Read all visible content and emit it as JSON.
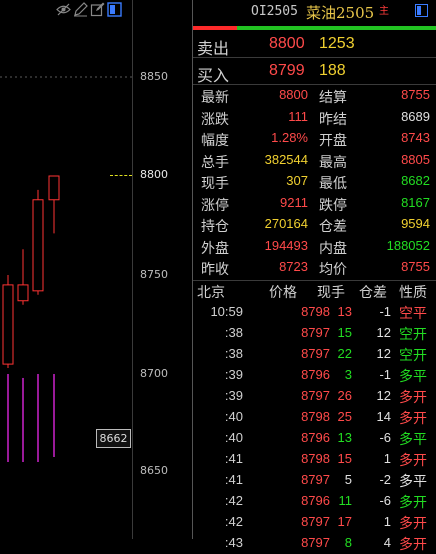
{
  "chart": {
    "price_labels": [
      "8850",
      "8800",
      "8750",
      "8700",
      "8650"
    ],
    "last_price_tag": "8800",
    "crosshair_tag": "8662",
    "candles": [
      {
        "open": 8705,
        "close": 8745,
        "high": 8750,
        "low": 8703,
        "color": "#ff3333"
      },
      {
        "open": 8745,
        "close": 8737,
        "high": 8763,
        "low": 8735,
        "color": "#ff3333"
      },
      {
        "open": 8742,
        "close": 8788,
        "high": 8793,
        "low": 8740,
        "color": "#ff3333"
      },
      {
        "open": 8788,
        "close": 8800,
        "high": 8800,
        "low": 8771,
        "color": "#ff3333"
      }
    ],
    "volume_bars": [
      8700,
      8698,
      8700,
      8700
    ],
    "colors": {
      "up": "#ff3333",
      "volume": "#cc22cc",
      "grid": "#3a3a3a"
    }
  },
  "toolbar": {
    "icons": [
      "eye-off-icon",
      "pencil-icon",
      "edit-icon",
      "window-icon"
    ]
  },
  "header": {
    "code": "OI2505",
    "name": "菜油2505",
    "badge": "主"
  },
  "orderbook": {
    "ask": {
      "label": "卖出",
      "price": "8800",
      "volume": "1253"
    },
    "bid": {
      "label": "买入",
      "price": "8799",
      "volume": "188"
    }
  },
  "stats": [
    {
      "l1": "最新",
      "v1": "8800",
      "c1": "red",
      "l2": "结算",
      "v2": "8755",
      "c2": "red"
    },
    {
      "l1": "涨跌",
      "v1": "111",
      "c1": "red",
      "l2": "昨结",
      "v2": "8689",
      "c2": "white"
    },
    {
      "l1": "幅度",
      "v1": "1.28%",
      "c1": "red",
      "l2": "开盘",
      "v2": "8743",
      "c2": "red"
    },
    {
      "l1": "总手",
      "v1": "382544",
      "c1": "yellow",
      "l2": "最高",
      "v2": "8805",
      "c2": "red"
    },
    {
      "l1": "现手",
      "v1": "307",
      "c1": "yellow",
      "l2": "最低",
      "v2": "8682",
      "c2": "green"
    },
    {
      "l1": "涨停",
      "v1": "9211",
      "c1": "red",
      "l2": "跌停",
      "v2": "8167",
      "c2": "green"
    },
    {
      "l1": "持仓",
      "v1": "270164",
      "c1": "yellow",
      "l2": "仓差",
      "v2": "9594",
      "c2": "yellow"
    },
    {
      "l1": "外盘",
      "v1": "194493",
      "c1": "red",
      "l2": "内盘",
      "v2": "188052",
      "c2": "green"
    },
    {
      "l1": "昨收",
      "v1": "8723",
      "c1": "red",
      "l2": "均价",
      "v2": "8755",
      "c2": "red"
    }
  ],
  "ticks_header": {
    "time": "北京",
    "price": "价格",
    "qty": "现手",
    "oi": "仓差",
    "nature": "性质"
  },
  "ticks": [
    {
      "t": "10:59",
      "p": "8798",
      "pc": "red",
      "q": "13",
      "qc": "red",
      "d": "-1",
      "k": "空平",
      "kc": "red"
    },
    {
      "t": ":38",
      "p": "8797",
      "pc": "red",
      "q": "15",
      "qc": "green",
      "d": "12",
      "k": "空开",
      "kc": "green"
    },
    {
      "t": ":38",
      "p": "8797",
      "pc": "red",
      "q": "22",
      "qc": "green",
      "d": "12",
      "k": "空开",
      "kc": "green"
    },
    {
      "t": ":39",
      "p": "8796",
      "pc": "red",
      "q": "3",
      "qc": "green",
      "d": "-1",
      "k": "多平",
      "kc": "green"
    },
    {
      "t": ":39",
      "p": "8797",
      "pc": "red",
      "q": "26",
      "qc": "red",
      "d": "12",
      "k": "多开",
      "kc": "red"
    },
    {
      "t": ":40",
      "p": "8798",
      "pc": "red",
      "q": "25",
      "qc": "red",
      "d": "14",
      "k": "多开",
      "kc": "red"
    },
    {
      "t": ":40",
      "p": "8796",
      "pc": "red",
      "q": "13",
      "qc": "green",
      "d": "-6",
      "k": "多平",
      "kc": "green"
    },
    {
      "t": ":41",
      "p": "8798",
      "pc": "red",
      "q": "15",
      "qc": "red",
      "d": "1",
      "k": "多开",
      "kc": "red"
    },
    {
      "t": ":41",
      "p": "8797",
      "pc": "red",
      "q": "5",
      "qc": "white",
      "d": "-2",
      "k": "多平",
      "kc": "white"
    },
    {
      "t": ":42",
      "p": "8796",
      "pc": "red",
      "q": "11",
      "qc": "green",
      "d": "-6",
      "k": "多开",
      "kc": "green"
    },
    {
      "t": ":42",
      "p": "8797",
      "pc": "red",
      "q": "17",
      "qc": "red",
      "d": "1",
      "k": "多开",
      "kc": "red"
    },
    {
      "t": ":43",
      "p": "8797",
      "pc": "red",
      "q": "8",
      "qc": "green",
      "d": "4",
      "k": "多开",
      "kc": "red"
    }
  ]
}
